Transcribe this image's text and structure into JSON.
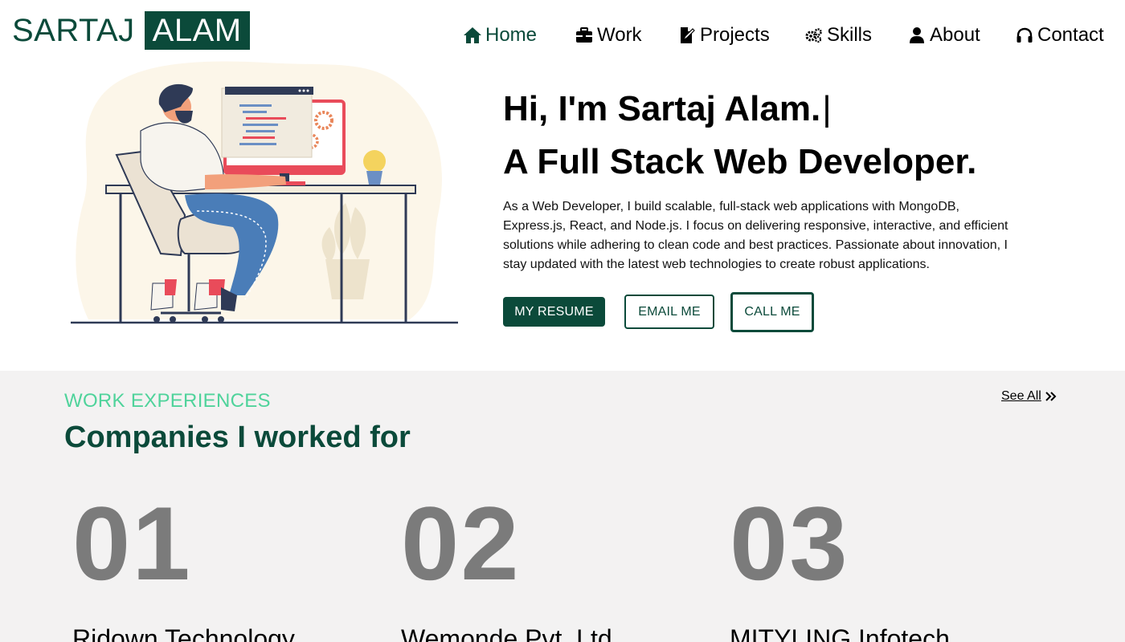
{
  "logo": {
    "first": "SARTAJ",
    "last": "ALAM"
  },
  "nav": {
    "items": [
      {
        "label": "Home",
        "icon": "home-icon",
        "active": true
      },
      {
        "label": "Work",
        "icon": "briefcase-icon",
        "active": false
      },
      {
        "label": "Projects",
        "icon": "file-edit-icon",
        "active": false
      },
      {
        "label": "Skills",
        "icon": "gears-icon",
        "active": false
      },
      {
        "label": "About",
        "icon": "user-icon",
        "active": false
      },
      {
        "label": "Contact",
        "icon": "headphones-icon",
        "active": false
      }
    ]
  },
  "hero": {
    "greeting": "Hi, I'm Sartaj Alam.",
    "caret": "|",
    "role": "A Full Stack Web Developer.",
    "description": "As a Web Developer, I build scalable, full-stack web applications with MongoDB, Express.js, React, and Node.js. I focus on delivering responsive, interactive, and efficient solutions while adhering to clean code and best practices. Passionate about innovation, I stay updated with the latest web technologies to create robust applications.",
    "buttons": {
      "resume": "MY RESUME",
      "email": "EMAIL ME",
      "call": "CALL ME"
    },
    "illustration": "developer-at-desk-illustration"
  },
  "work": {
    "eyebrow": "WORK EXPERIENCES",
    "heading": "Companies I worked for",
    "see_all": "See All",
    "companies": [
      {
        "number": "01",
        "name": "Ridown Technology"
      },
      {
        "number": "02",
        "name": "Wemonde Pvt. Ltd."
      },
      {
        "number": "03",
        "name": "MITYLING Infotech"
      }
    ]
  },
  "colors": {
    "brand": "#0b4a3a",
    "accent": "#4fd39b",
    "section_bg": "#f3f2f2",
    "number_gray": "#7b7b7b"
  }
}
